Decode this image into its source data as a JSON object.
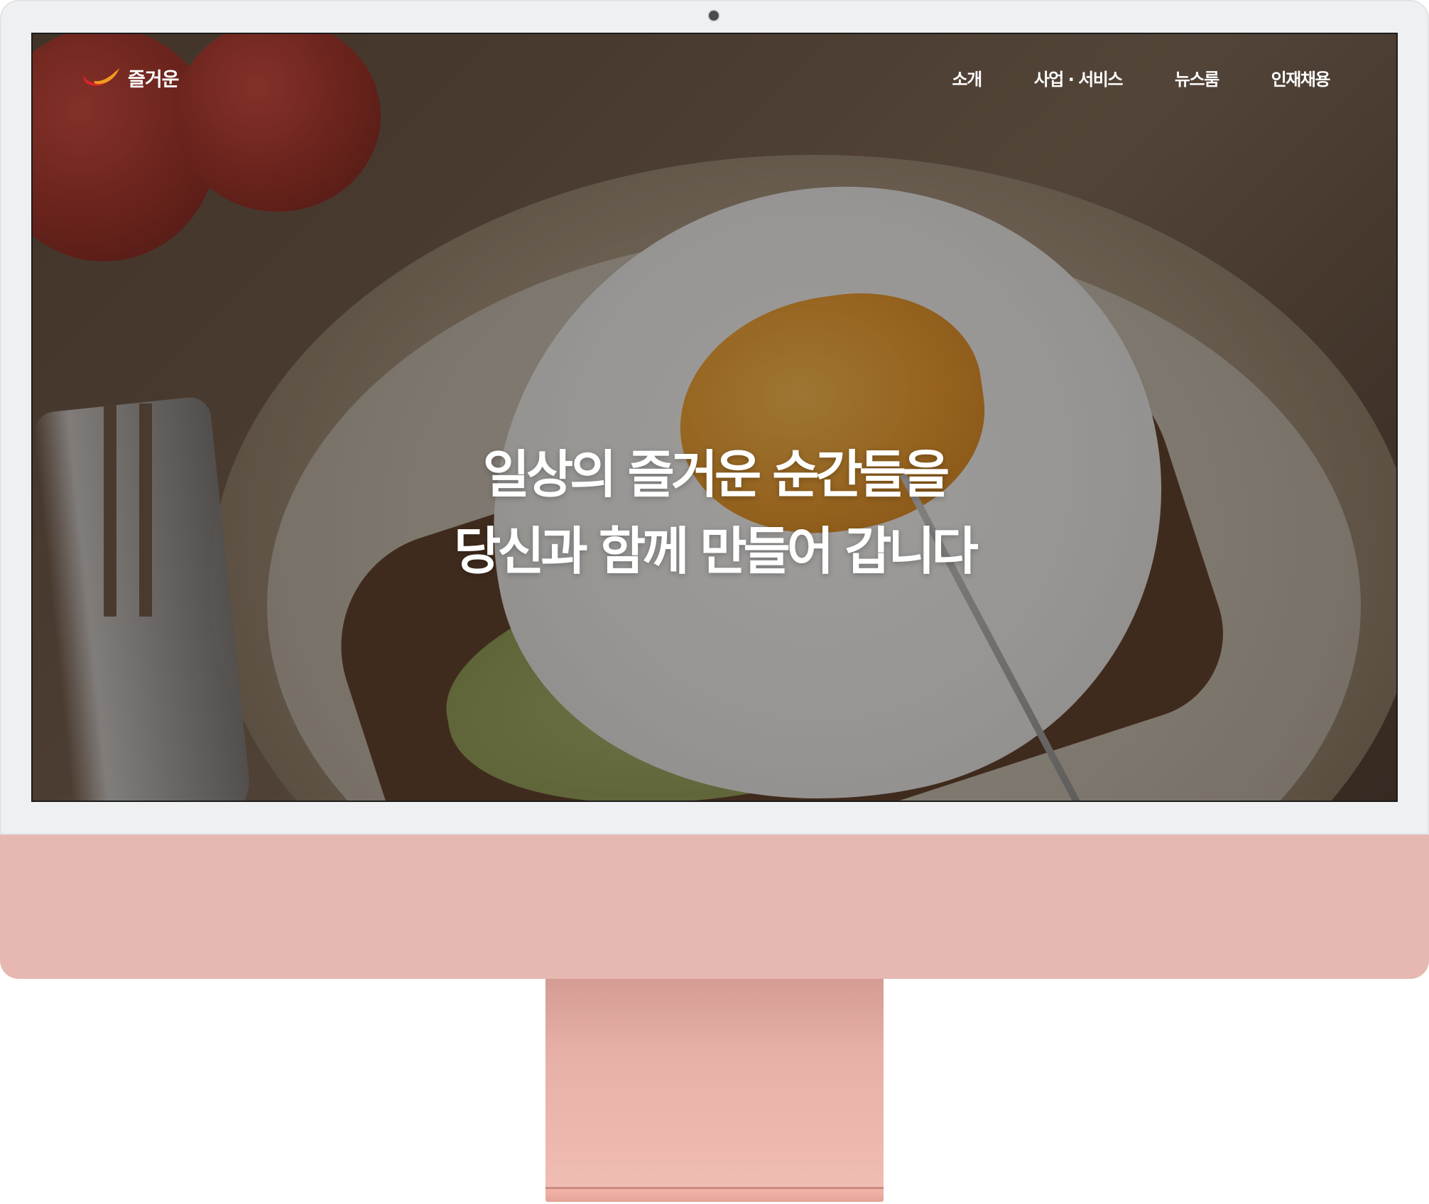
{
  "site": {
    "logo_text": "즐거운",
    "logo_icon": "swoosh-logo-icon",
    "nav": [
      {
        "label": "소개"
      },
      {
        "label": "사업 · 서비스"
      },
      {
        "label": "뉴스룸"
      },
      {
        "label": "인재채용"
      }
    ]
  },
  "hero": {
    "line1": "일상의 즐거운 순간들을",
    "line2": "당신과 함께 만들어 갑니다"
  },
  "colors": {
    "logo_red": "#d8262b",
    "logo_orange": "#f29c1f",
    "monitor_frame": "#eff0f2",
    "monitor_chin": "#e6b8b1",
    "stand": "#e6b0a6"
  }
}
